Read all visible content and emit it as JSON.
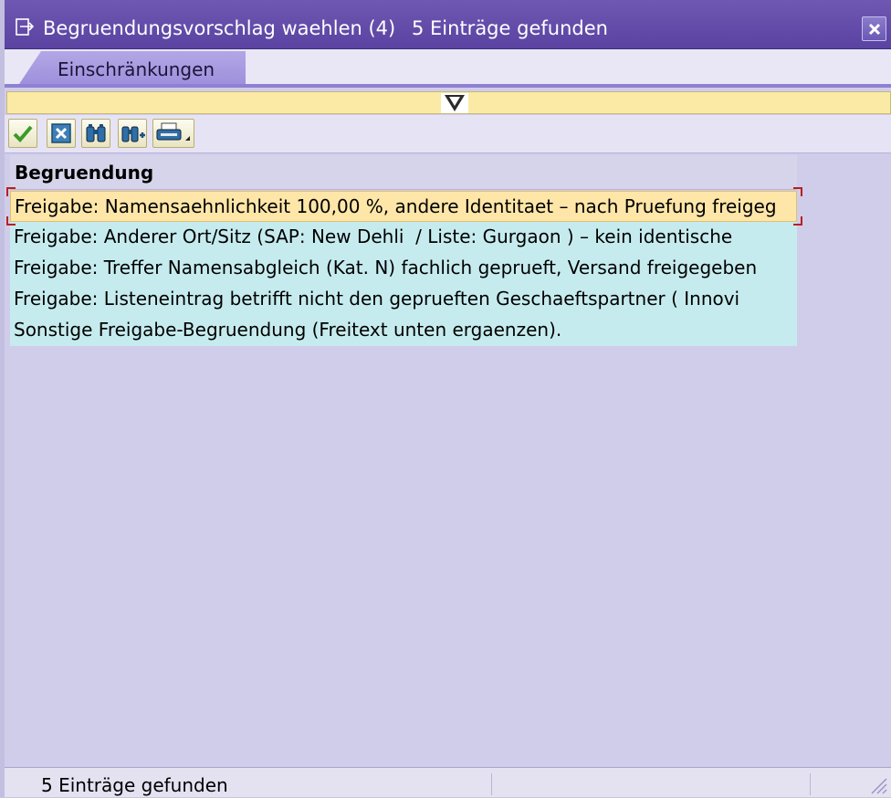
{
  "window": {
    "title": "Begruendungsvorschlag waehlen (4)",
    "title_count": "5 Einträge gefunden",
    "close_icon": "close-icon"
  },
  "tabs": [
    {
      "label": "Einschränkungen",
      "active": true
    }
  ],
  "toolbar": {
    "buttons": [
      {
        "name": "confirm-button",
        "icon": "checkmark-icon"
      },
      {
        "name": "cancel-button",
        "icon": "close-icon"
      },
      {
        "name": "find-button",
        "icon": "binoculars-icon"
      },
      {
        "name": "find-next-button",
        "icon": "binoculars-plus-icon"
      },
      {
        "name": "print-button",
        "icon": "printer-icon"
      }
    ]
  },
  "list": {
    "header": "Begruendung",
    "rows": [
      "Freigabe: Namensaehnlichkeit 100,00 %, andere Identitaet – nach Pruefung freigeg",
      "Freigabe: Anderer Ort/Sitz (SAP: New Dehli  / Liste: Gurgaon ) – kein identische",
      "Freigabe: Treffer Namensabgleich (Kat. N) fachlich geprueft, Versand freigegeben",
      "Freigabe: Listeneintrag betrifft nicht den geprueften Geschaeftspartner ( Innovi",
      "Sonstige Freigabe-Begruendung (Freitext unten ergaenzen)."
    ],
    "selected_index": 0
  },
  "status": {
    "text": "5 Einträge gefunden"
  },
  "colors": {
    "title_bar": "#5a43a1",
    "row_bg": "#c6ebee",
    "selected_row_bg": "#fde6a8",
    "body_bg": "#d0cdea"
  }
}
